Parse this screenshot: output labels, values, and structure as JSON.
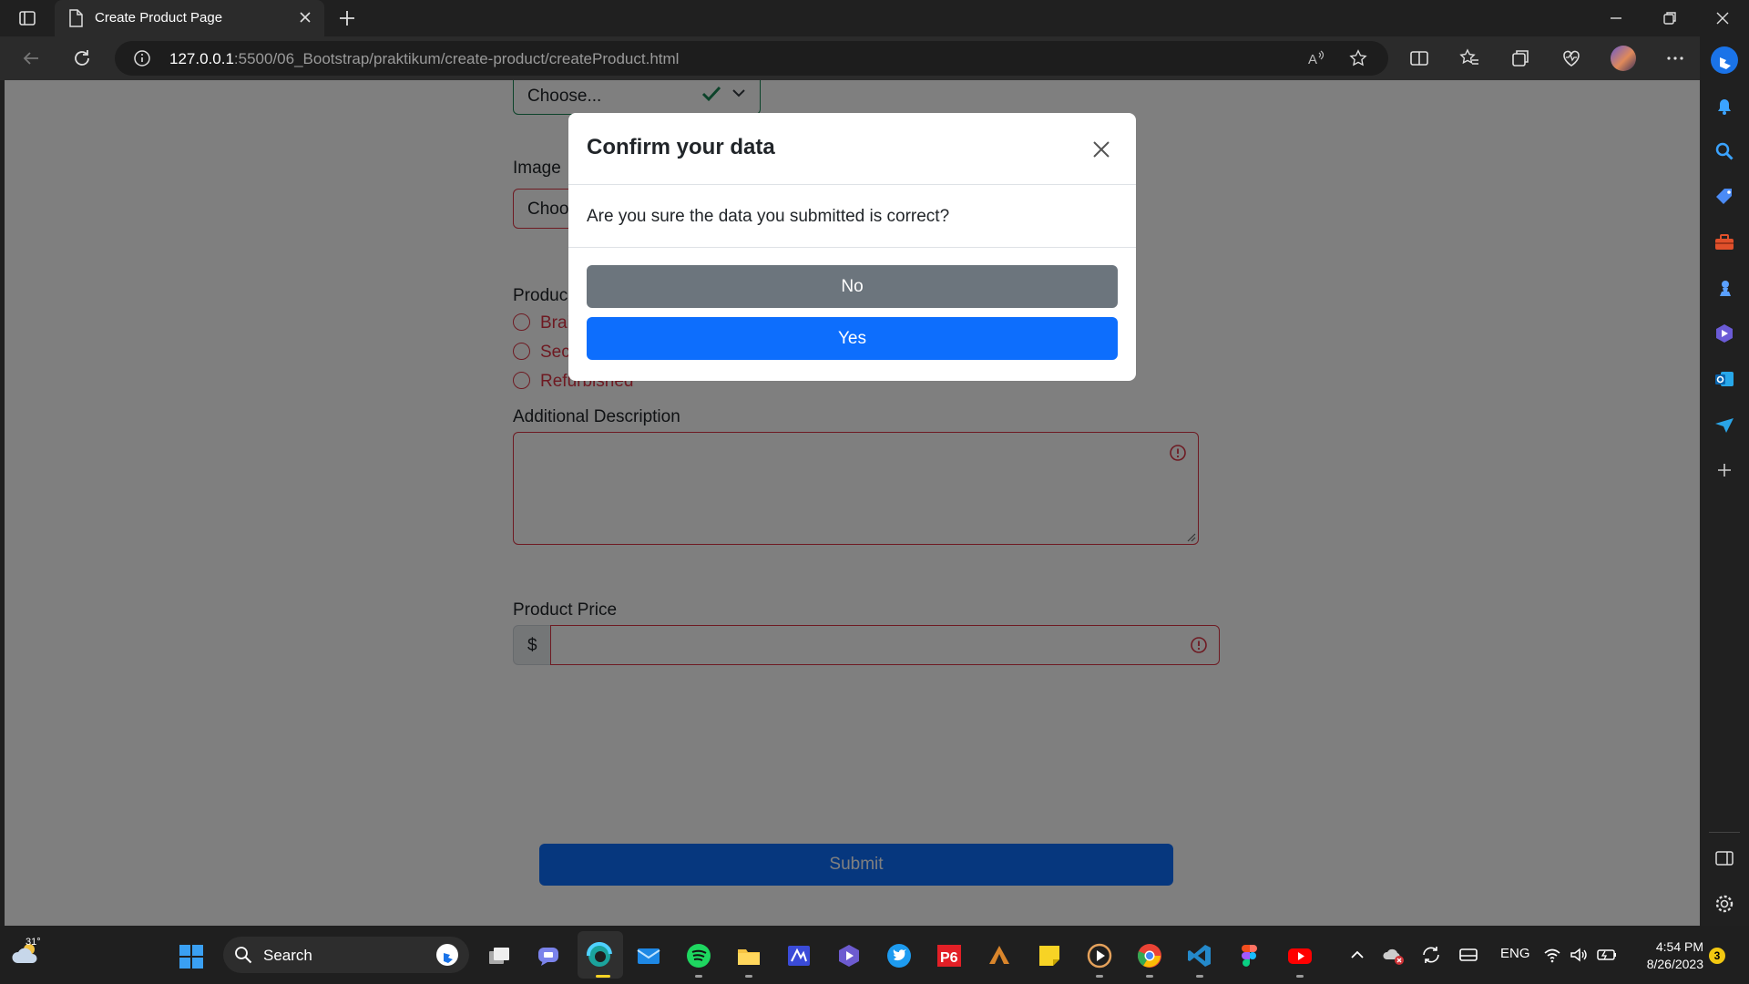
{
  "browser": {
    "tab_title": "Create Product Page",
    "url_host": "127.0.0.1",
    "url_rest": ":5500/06_Bootstrap/praktikum/create-product/createProduct.html"
  },
  "form": {
    "category_value": "Choose...",
    "image_label": "Image",
    "image_input_text": "Choo",
    "product_label": "Produc",
    "radio_options": [
      "Brai",
      "Sec",
      "Refurbished"
    ],
    "additional_description_label": "Additional Description",
    "price_label": "Product Price",
    "price_prefix": "$",
    "submit_label": "Submit"
  },
  "modal": {
    "title": "Confirm your data",
    "message": "Are you sure the data you submitted is correct?",
    "no_label": "No",
    "yes_label": "Yes"
  },
  "taskbar": {
    "temperature": "31°",
    "search_placeholder": "Search",
    "language": "ENG",
    "time": "4:54 PM",
    "date": "8/26/2023",
    "notification_count": "3"
  },
  "colors": {
    "primary": "#0d6efd",
    "secondary": "#6c757d",
    "danger": "#dc3545",
    "success": "#198754"
  },
  "icons": {
    "sidebar": [
      "bell-icon",
      "search-icon",
      "tag-icon",
      "toolbox-icon",
      "chess-icon",
      "copilot-icon",
      "outlook-icon",
      "send-icon",
      "plus-icon",
      "sidebar-panel-icon",
      "settings-icon"
    ]
  }
}
